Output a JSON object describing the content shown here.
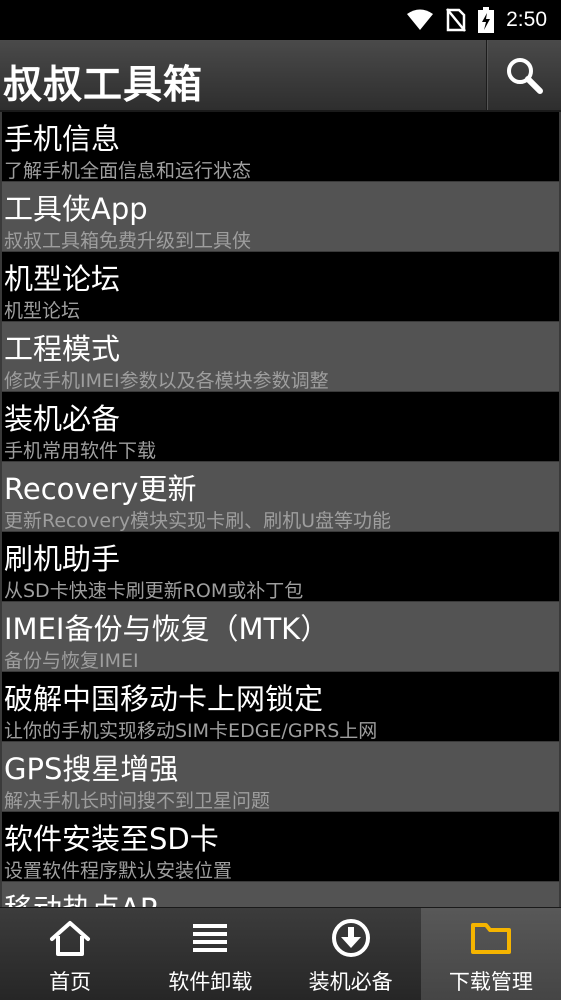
{
  "status_bar": {
    "time": "2:50",
    "icons": [
      "wifi-icon",
      "no-sim-icon",
      "battery-charging-icon"
    ]
  },
  "app_bar": {
    "title": "叔叔工具箱",
    "search_icon": "search-icon"
  },
  "list": {
    "items": [
      {
        "title": "手机信息",
        "desc": "了解手机全面信息和运行状态"
      },
      {
        "title": "工具侠App",
        "desc": "叔叔工具箱免费升级到工具侠"
      },
      {
        "title": "机型论坛",
        "desc": "机型论坛"
      },
      {
        "title": "工程模式",
        "desc": "修改手机IMEI参数以及各模块参数调整"
      },
      {
        "title": "装机必备",
        "desc": "手机常用软件下载"
      },
      {
        "title": "Recovery更新",
        "desc": "更新Recovery模块实现卡刷、刷机U盘等功能"
      },
      {
        "title": "刷机助手",
        "desc": "从SD卡快速卡刷更新ROM或补丁包"
      },
      {
        "title": "IMEI备份与恢复（MTK）",
        "desc": "备份与恢复IMEI"
      },
      {
        "title": "破解中国移动卡上网锁定",
        "desc": "让你的手机实现移动SIM卡EDGE/GPRS上网"
      },
      {
        "title": "GPS搜星增强",
        "desc": "解决手机长时间搜不到卫星问题"
      },
      {
        "title": "软件安装至SD卡",
        "desc": "设置软件程序默认安装位置"
      },
      {
        "title": "移动热点AP",
        "desc": ""
      }
    ]
  },
  "bottom_nav": {
    "items": [
      {
        "label": "首页",
        "icon": "home-icon"
      },
      {
        "label": "软件卸载",
        "icon": "menu-lines-icon"
      },
      {
        "label": "装机必备",
        "icon": "download-circle-icon"
      },
      {
        "label": "下载管理",
        "icon": "folder-icon",
        "active": true
      }
    ]
  },
  "colors": {
    "accent": "#f5b400",
    "row_dark": "#000000",
    "row_light": "#535353",
    "desc_text": "#9e9e9e"
  }
}
